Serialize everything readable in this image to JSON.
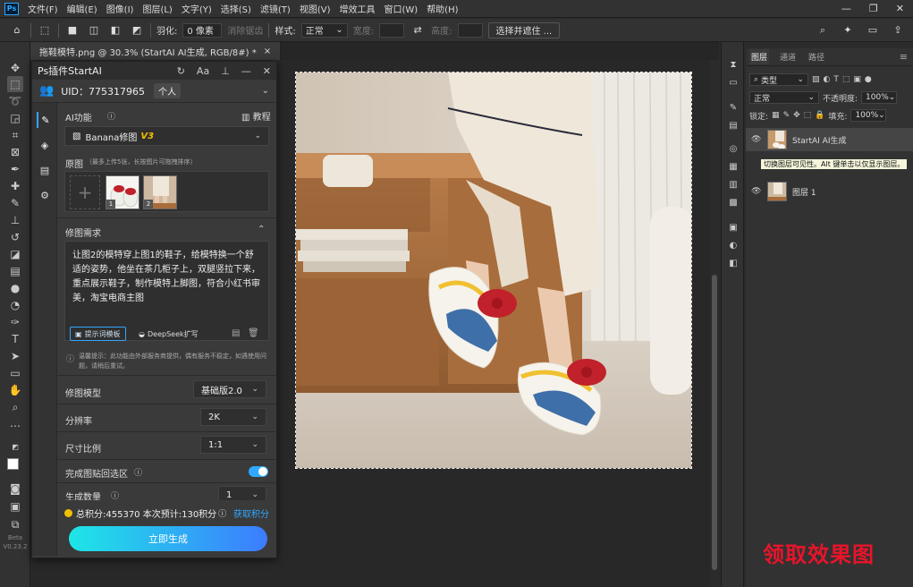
{
  "menubar": {
    "logo": "Ps",
    "items": [
      "文件(F)",
      "编辑(E)",
      "图像(I)",
      "图层(L)",
      "文字(Y)",
      "选择(S)",
      "滤镜(T)",
      "视图(V)",
      "增效工具",
      "窗口(W)",
      "帮助(H)"
    ],
    "window_controls": [
      "—",
      "❐",
      "✕"
    ]
  },
  "options_bar": {
    "feather_label": "羽化:",
    "feather_value": "0 像素",
    "antialias_label": "消除锯齿",
    "style_label": "样式:",
    "style_value": "正常",
    "width_label": "宽度:",
    "height_label": "高度:",
    "select_mask_button": "选择并遮住 ..."
  },
  "document_tab": {
    "title": "拖鞋模特.png @ 30.3% (StartAI AI生成, RGB/8#) *",
    "close": "×"
  },
  "toolbar": {
    "version_line1": "Beta",
    "version_line2": "V0.23.2"
  },
  "plugin": {
    "title": "Ps插件StartAI",
    "uid_label": "UID：775317965",
    "account_type": "个人",
    "ai_function_label": "AI功能",
    "tutorial_label": "教程",
    "function_select": "Banana修图",
    "function_version": "V3",
    "source_label": "原图",
    "source_hint": "（最多上传5张，长按图片可拖拽排序）",
    "thumb_numbers": [
      "1",
      "2"
    ],
    "requirement_label": "修图需求",
    "requirement_text": "让图2的模特穿上图1的鞋子，给模特换一个舒适的姿势，他坐在茶几柜子上，双腿竖拉下来，重点展示鞋子，制作模特上脚图，符合小红书审美，淘宝电商主图",
    "prompt_template_chip": "提示词模板",
    "deepseek_chip": "DeepSeek扩写",
    "notice_text": "温馨提示：此功能由外部服务商提供，偶有服务不稳定，如遇使用问题，请稍后重试。",
    "rows": [
      {
        "label": "修图模型",
        "value": "基础版2.0"
      },
      {
        "label": "分辨率",
        "value": "2K"
      },
      {
        "label": "尺寸比例",
        "value": "1:1"
      }
    ],
    "paste_back_label": "完成图贴回选区",
    "count_label": "生成数量",
    "count_value": "1",
    "credits_text": "总积分:455370  本次预计:130积分",
    "get_credits_link": "获取积分",
    "generate_button": "立即生成"
  },
  "layers_panel": {
    "tabs": [
      "图层",
      "通道",
      "路径"
    ],
    "filter_value": "类型",
    "blend_mode": "正常",
    "opacity_label": "不透明度:",
    "opacity_value": "100%",
    "lock_label": "锁定:",
    "fill_label": "填充:",
    "fill_value": "100%",
    "layers": [
      {
        "name": "StartAI AI生成"
      },
      {
        "name": "图层 1"
      }
    ],
    "tooltip": "切换图层可见性。Alt 键单击以仅显示图层。"
  },
  "watermark": "领取效果图",
  "colors": {
    "accent": "#31a8ff",
    "generate_start": "#1ee6e6",
    "generate_end": "#3c7cff",
    "watermark_red": "#e8142a",
    "version_gold": "#f0c000"
  }
}
